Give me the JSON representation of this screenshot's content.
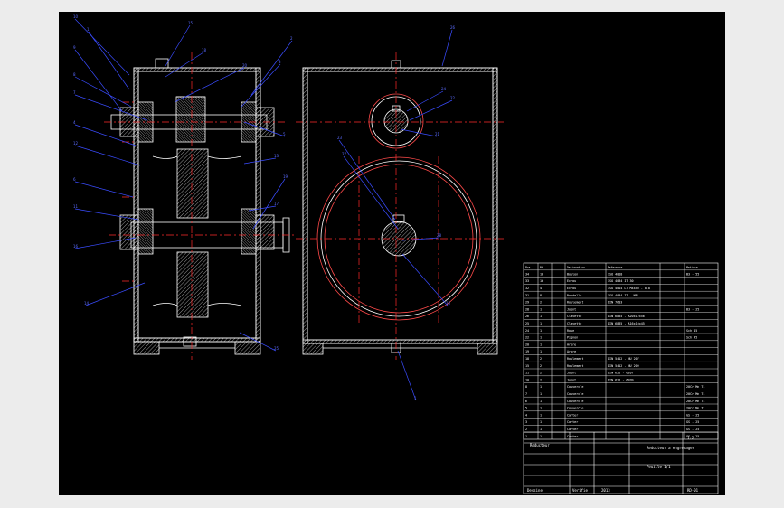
{
  "bom_rows": [
    {
      "pos": "34",
      "qty": "16",
      "desc": "Boulon",
      "std": "ISO 4018",
      "mat": "B3 - 55",
      "spec": ""
    },
    {
      "pos": "33",
      "qty": "16",
      "desc": "Ecrou",
      "std": "ISO 4034 IT 30",
      "mat": "",
      "spec": ""
    },
    {
      "pos": "32",
      "qty": "4",
      "desc": "Ecrou",
      "std": "ISO 4014 L7 M4x40 - 8.8",
      "mat": "",
      "spec": ""
    },
    {
      "pos": "31",
      "qty": "8",
      "desc": "Rondelle",
      "std": "ISO 4034 IT - M8",
      "mat": "",
      "spec": ""
    },
    {
      "pos": "29",
      "qty": "2",
      "desc": "Roulement",
      "std": "DIN 7603",
      "mat": "",
      "spec": ""
    },
    {
      "pos": "28",
      "qty": "1",
      "desc": "Joint",
      "std": "",
      "mat": "B3 - 25",
      "spec": ""
    },
    {
      "pos": "26",
      "qty": "1",
      "desc": "Clavette",
      "std": "DIN 6885 - A20x12x56",
      "mat": "",
      "spec": ""
    },
    {
      "pos": "25",
      "qty": "1",
      "desc": "Clavette",
      "std": "DIN 6885 - A16x10x45",
      "mat": "",
      "spec": ""
    },
    {
      "pos": "24",
      "qty": "1",
      "desc": "Roue",
      "std": "",
      "mat": "Sch 45",
      "spec": ""
    },
    {
      "pos": "22",
      "qty": "1",
      "desc": "Pignon",
      "std": "",
      "mat": "Sch 45",
      "spec": ""
    },
    {
      "pos": "20",
      "qty": "1",
      "desc": "Arbre",
      "std": "",
      "mat": "",
      "spec": ""
    },
    {
      "pos": "19",
      "qty": "1",
      "desc": "Arbre",
      "std": "",
      "mat": "",
      "spec": ""
    },
    {
      "pos": "18",
      "qty": "2",
      "desc": "Roulement",
      "std": "DIN 5412 - NU 207",
      "mat": "",
      "spec": ""
    },
    {
      "pos": "15",
      "qty": "2",
      "desc": "Roulement",
      "std": "DIN 5412 - NU 209",
      "mat": "",
      "spec": ""
    },
    {
      "pos": "11",
      "qty": "2",
      "desc": "Joint",
      "std": "DIN 625 - 6207",
      "mat": "",
      "spec": ""
    },
    {
      "pos": "10",
      "qty": "2",
      "desc": "Joint",
      "std": "DIN 625 - 6209",
      "mat": "",
      "spec": ""
    },
    {
      "pos": "8",
      "qty": "1",
      "desc": "Couvercle",
      "std": "",
      "mat": "20Cr Mn Ti",
      "spec": ""
    },
    {
      "pos": "7",
      "qty": "1",
      "desc": "Couvercle",
      "std": "",
      "mat": "20Cr Mn Ti",
      "spec": ""
    },
    {
      "pos": "6",
      "qty": "1",
      "desc": "Couvercle",
      "std": "",
      "mat": "20Cr Mn Ti",
      "spec": ""
    },
    {
      "pos": "5",
      "qty": "1",
      "desc": "Couvercle",
      "std": "",
      "mat": "20Cr Mn Ti",
      "spec": ""
    },
    {
      "pos": "4",
      "qty": "1",
      "desc": "Carter",
      "std": "",
      "mat": "GS - 25",
      "spec": ""
    },
    {
      "pos": "3",
      "qty": "1",
      "desc": "Carter",
      "std": "",
      "mat": "GS - 25",
      "spec": ""
    },
    {
      "pos": "2",
      "qty": "1",
      "desc": "Carter",
      "std": "",
      "mat": "GS - 25",
      "spec": ""
    },
    {
      "pos": "1",
      "qty": "1",
      "desc": "Carter",
      "std": "",
      "mat": "GS - 25",
      "spec": ""
    }
  ],
  "bom_header": {
    "pos": "Pos",
    "qty": "Nb",
    "desc": "Designation",
    "std": "Reference",
    "mat": "Matiere"
  },
  "title_block": {
    "drawing_title": "Reducteur",
    "scale": "1:2",
    "sheet": "Feuille 1/1",
    "designation": "Reducteur a engrenages",
    "drawn_by": "Dessine",
    "checked_by": "Verifie",
    "date": "2013",
    "number": "RD-01"
  },
  "leader_numbers": [
    "10",
    "1",
    "9",
    "8",
    "7",
    "4",
    "12",
    "6",
    "11",
    "16",
    "14",
    "15",
    "18",
    "20",
    "2",
    "3",
    "5",
    "13",
    "17",
    "19",
    "25",
    "26",
    "24",
    "22",
    "21",
    "23",
    "27",
    "28"
  ],
  "colors": {
    "background": "#000000",
    "outline": "#ffffff",
    "hatch": "#ffffff",
    "centerline": "#ff2a2a",
    "leader": "#3a4cff",
    "gear_circle": "#ff4a4a",
    "table": "#ffffff"
  }
}
